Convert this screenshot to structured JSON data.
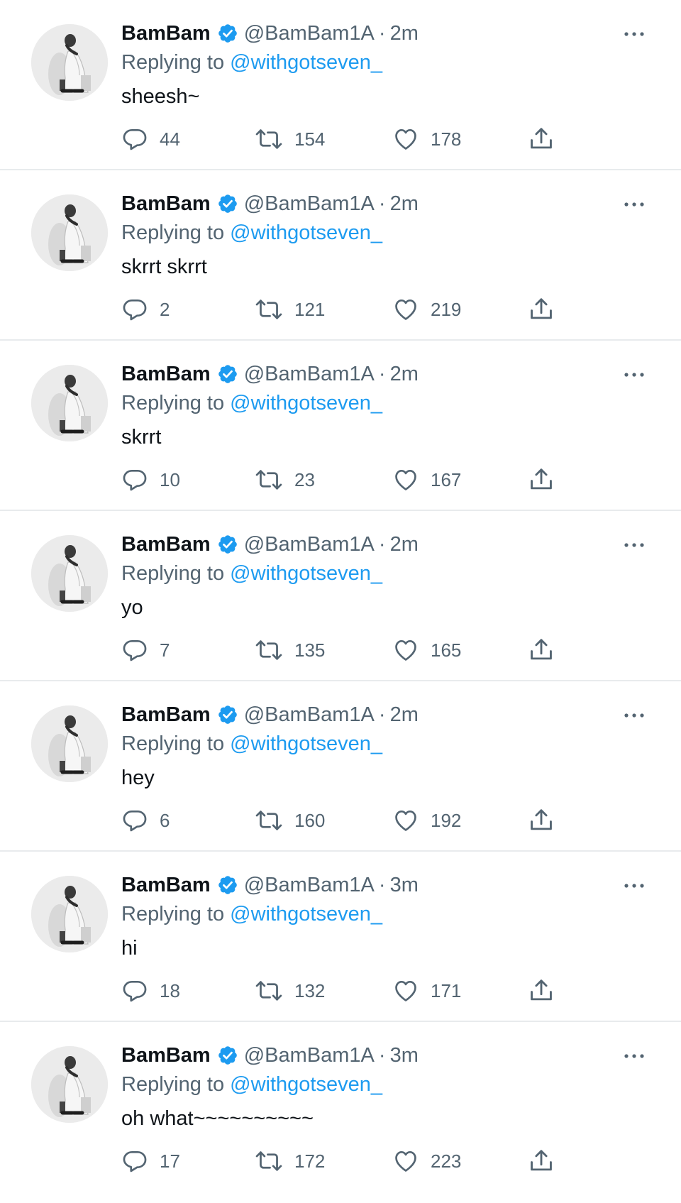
{
  "colors": {
    "accent": "#1d9bf0",
    "secondary_text": "#536471",
    "primary_text": "#0f1419",
    "divider": "#e8ebed"
  },
  "icons": {
    "verified": "verified-badge-icon",
    "more": "more-options-icon",
    "reply": "reply-icon",
    "retweet": "retweet-icon",
    "like": "heart-icon",
    "share": "share-icon"
  },
  "tweets": [
    {
      "name": "BamBam",
      "handle": "@BamBam1A",
      "separator": "·",
      "time": "2m",
      "replying_prefix": "Replying to",
      "replying_to": "@withgotseven_",
      "text": "sheesh~",
      "replies": "44",
      "retweets": "154",
      "likes": "178"
    },
    {
      "name": "BamBam",
      "handle": "@BamBam1A",
      "separator": "·",
      "time": "2m",
      "replying_prefix": "Replying to",
      "replying_to": "@withgotseven_",
      "text": "skrrt skrrt",
      "replies": "2",
      "retweets": "121",
      "likes": "219"
    },
    {
      "name": "BamBam",
      "handle": "@BamBam1A",
      "separator": "·",
      "time": "2m",
      "replying_prefix": "Replying to",
      "replying_to": "@withgotseven_",
      "text": "skrrt",
      "replies": "10",
      "retweets": "23",
      "likes": "167"
    },
    {
      "name": "BamBam",
      "handle": "@BamBam1A",
      "separator": "·",
      "time": "2m",
      "replying_prefix": "Replying to",
      "replying_to": "@withgotseven_",
      "text": "yo",
      "replies": "7",
      "retweets": "135",
      "likes": "165"
    },
    {
      "name": "BamBam",
      "handle": "@BamBam1A",
      "separator": "·",
      "time": "2m",
      "replying_prefix": "Replying to",
      "replying_to": "@withgotseven_",
      "text": "hey",
      "replies": "6",
      "retweets": "160",
      "likes": "192"
    },
    {
      "name": "BamBam",
      "handle": "@BamBam1A",
      "separator": "·",
      "time": "3m",
      "replying_prefix": "Replying to",
      "replying_to": "@withgotseven_",
      "text": "hi",
      "replies": "18",
      "retweets": "132",
      "likes": "171"
    },
    {
      "name": "BamBam",
      "handle": "@BamBam1A",
      "separator": "·",
      "time": "3m",
      "replying_prefix": "Replying to",
      "replying_to": "@withgotseven_",
      "text": "oh what~~~~~~~~~~",
      "replies": "17",
      "retweets": "172",
      "likes": "223"
    }
  ]
}
